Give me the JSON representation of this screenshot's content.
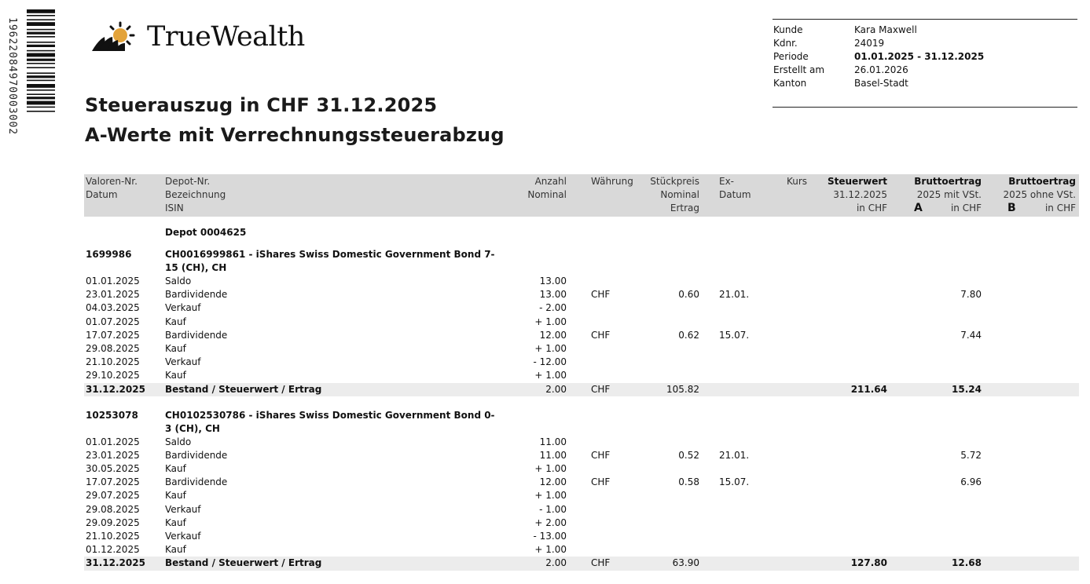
{
  "barcode": {
    "number": "19622084970003002"
  },
  "logo": {
    "name": "TrueWealth"
  },
  "title": "Steuerauszug in CHF 31.12.2025",
  "subtitle": "A-Werte mit Verrechnungssteuerabzug",
  "info": [
    {
      "label": "Kunde",
      "value": "Kara Maxwell",
      "bold": false
    },
    {
      "label": "Kdnr.",
      "value": "24019",
      "bold": false
    },
    {
      "label": "Periode",
      "value": "01.01.2025 - 31.12.2025",
      "bold": true
    },
    {
      "label": "Erstellt am",
      "value": "26.01.2026",
      "bold": false
    },
    {
      "label": "Kanton",
      "value": "Basel-Stadt",
      "bold": false
    }
  ],
  "header": {
    "col1": [
      "Valoren-Nr.",
      "Datum"
    ],
    "col2": [
      "Depot-Nr.",
      "Bezeichnung",
      "ISIN"
    ],
    "col3": [
      "Anzahl",
      "Nominal"
    ],
    "col4": [
      "Währung"
    ],
    "col5": [
      "Stückpreis",
      "Nominal",
      "Ertrag"
    ],
    "col6": [
      "Ex-",
      "Datum"
    ],
    "col7": [
      "Kurs"
    ],
    "col8": [
      "Steuerwert",
      "31.12.2025",
      "in CHF"
    ],
    "col9": [
      "Bruttoertrag",
      "2025 mit VSt.",
      "in CHF"
    ],
    "col9_mark": "A",
    "col10": [
      "Bruttoertrag",
      "2025 ohne VSt.",
      "in CHF"
    ],
    "col10_mark": "B"
  },
  "depot": "Depot 0004625",
  "securities": [
    {
      "valor": "1699986",
      "name": "CH0016999861 - iShares Swiss Domestic Government Bond 7-15 (CH), CH",
      "rows": [
        {
          "date": "01.01.2025",
          "text": "Saldo",
          "qty": "13.00",
          "cur": "",
          "price": "",
          "ex": "",
          "val": "",
          "a": ""
        },
        {
          "date": "23.01.2025",
          "text": "Bardividende",
          "qty": "13.00",
          "cur": "CHF",
          "price": "0.60",
          "ex": "21.01.",
          "val": "",
          "a": "7.80"
        },
        {
          "date": "04.03.2025",
          "text": "Verkauf",
          "qty": "- 2.00",
          "cur": "",
          "price": "",
          "ex": "",
          "val": "",
          "a": ""
        },
        {
          "date": "01.07.2025",
          "text": "Kauf",
          "qty": "+ 1.00",
          "cur": "",
          "price": "",
          "ex": "",
          "val": "",
          "a": ""
        },
        {
          "date": "17.07.2025",
          "text": "Bardividende",
          "qty": "12.00",
          "cur": "CHF",
          "price": "0.62",
          "ex": "15.07.",
          "val": "",
          "a": "7.44"
        },
        {
          "date": "29.08.2025",
          "text": "Kauf",
          "qty": "+ 1.00",
          "cur": "",
          "price": "",
          "ex": "",
          "val": "",
          "a": ""
        },
        {
          "date": "21.10.2025",
          "text": "Verkauf",
          "qty": "- 12.00",
          "cur": "",
          "price": "",
          "ex": "",
          "val": "",
          "a": ""
        },
        {
          "date": "29.10.2025",
          "text": "Kauf",
          "qty": "+ 1.00",
          "cur": "",
          "price": "",
          "ex": "",
          "val": "",
          "a": ""
        }
      ],
      "total": {
        "date": "31.12.2025",
        "text": "Bestand / Steuerwert / Ertrag",
        "qty": "2.00",
        "cur": "CHF",
        "price": "105.82",
        "val": "211.64",
        "a": "15.24"
      }
    },
    {
      "valor": "10253078",
      "name": "CH0102530786 - iShares Swiss Domestic Government Bond 0-3 (CH), CH",
      "rows": [
        {
          "date": "01.01.2025",
          "text": "Saldo",
          "qty": "11.00",
          "cur": "",
          "price": "",
          "ex": "",
          "val": "",
          "a": ""
        },
        {
          "date": "23.01.2025",
          "text": "Bardividende",
          "qty": "11.00",
          "cur": "CHF",
          "price": "0.52",
          "ex": "21.01.",
          "val": "",
          "a": "5.72"
        },
        {
          "date": "30.05.2025",
          "text": "Kauf",
          "qty": "+ 1.00",
          "cur": "",
          "price": "",
          "ex": "",
          "val": "",
          "a": ""
        },
        {
          "date": "17.07.2025",
          "text": "Bardividende",
          "qty": "12.00",
          "cur": "CHF",
          "price": "0.58",
          "ex": "15.07.",
          "val": "",
          "a": "6.96"
        },
        {
          "date": "29.07.2025",
          "text": "Kauf",
          "qty": "+ 1.00",
          "cur": "",
          "price": "",
          "ex": "",
          "val": "",
          "a": ""
        },
        {
          "date": "29.08.2025",
          "text": "Verkauf",
          "qty": "- 1.00",
          "cur": "",
          "price": "",
          "ex": "",
          "val": "",
          "a": ""
        },
        {
          "date": "29.09.2025",
          "text": "Kauf",
          "qty": "+ 2.00",
          "cur": "",
          "price": "",
          "ex": "",
          "val": "",
          "a": ""
        },
        {
          "date": "21.10.2025",
          "text": "Verkauf",
          "qty": "- 13.00",
          "cur": "",
          "price": "",
          "ex": "",
          "val": "",
          "a": ""
        },
        {
          "date": "01.12.2025",
          "text": "Kauf",
          "qty": "+ 1.00",
          "cur": "",
          "price": "",
          "ex": "",
          "val": "",
          "a": ""
        }
      ],
      "total": {
        "date": "31.12.2025",
        "text": "Bestand / Steuerwert / Ertrag",
        "qty": "2.00",
        "cur": "CHF",
        "price": "63.90",
        "val": "127.80",
        "a": "12.68"
      }
    }
  ]
}
